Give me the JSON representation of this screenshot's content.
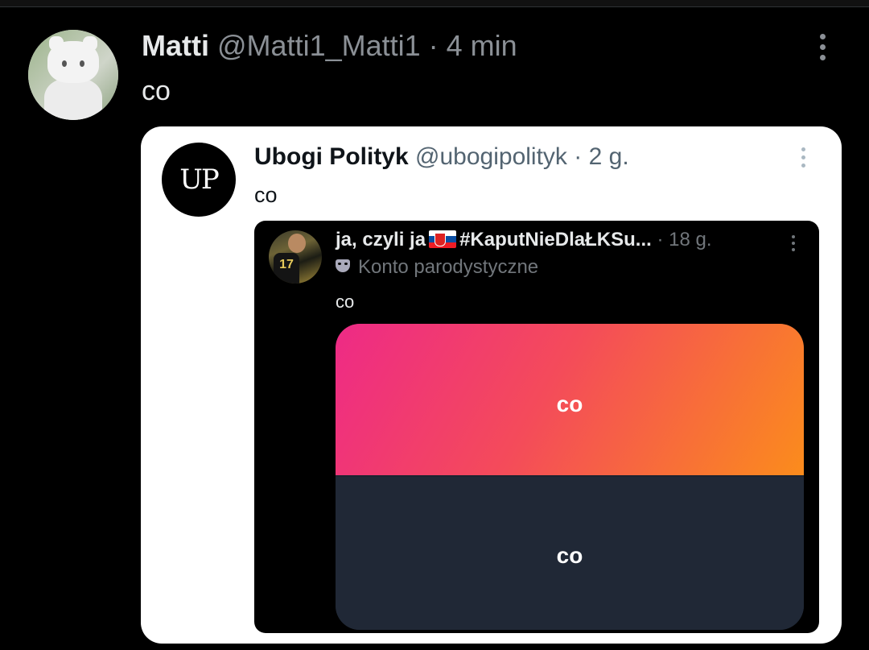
{
  "outer_tweet": {
    "name": "Matti",
    "handle": "@Matti1_Matti1",
    "time": "4 min",
    "text": "co"
  },
  "quoted_tweet": {
    "name": "Ubogi Polityk",
    "handle": "@ubogipolityk",
    "time": "2 g.",
    "text": "co",
    "avatar_text": "UP"
  },
  "nested_tweet": {
    "name_prefix": "ja, czyli ja",
    "name_suffix": "#KaputNieDlaŁKSu...",
    "time": "18 g.",
    "label": "Konto parodystyczne",
    "text": "co",
    "avatar_number": "17"
  },
  "poll": {
    "option_top": "co",
    "option_bottom": "co"
  },
  "colors": {
    "gradient_start": "#ee2a86",
    "gradient_end": "#fb8c1c",
    "dark_panel": "#202836"
  }
}
